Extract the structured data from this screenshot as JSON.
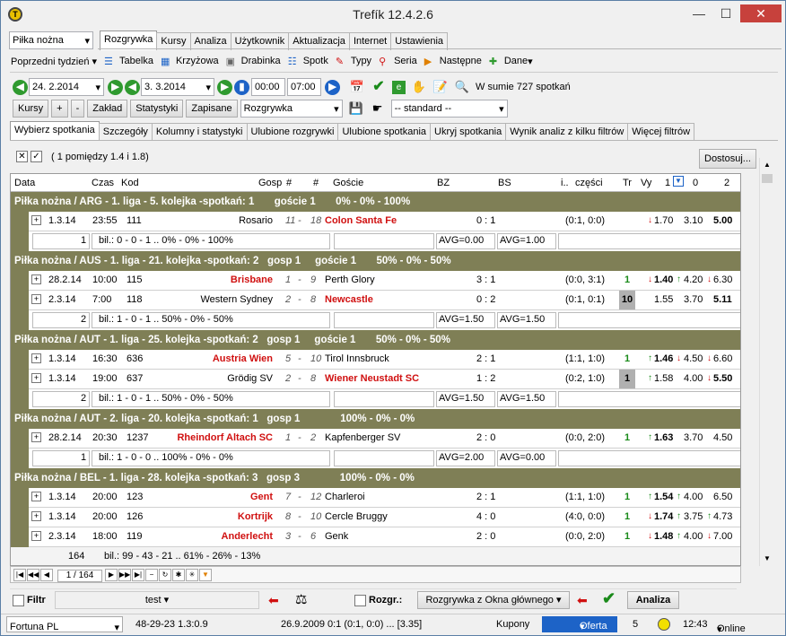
{
  "app": {
    "title": "Trefík 12.4.2.6"
  },
  "toolbar1": {
    "sport": "Piłka nożna",
    "period": "Poprzedni tydzień"
  },
  "main_tabs": [
    "Rozgrywka",
    "Kursy",
    "Analiza",
    "Użytkownik",
    "Aktualizacja",
    "Internet",
    "Ustawienia"
  ],
  "toolbar2": [
    "Tabelka",
    "Krzyżowa",
    "Drabinka",
    "Spotk",
    "Typy",
    "Seria",
    "Następne",
    "Dane"
  ],
  "toolbar3": {
    "date_from": "24. 2.2014",
    "date_to": "3. 3.2014",
    "time_from": "00:00",
    "time_to": "07:00",
    "total": "W sumie 727 spotkań"
  },
  "toolbar4": {
    "kursy": "Kursy",
    "plus": "+",
    "minus": "-",
    "zaklad": "Zakład",
    "statystyki": "Statystyki",
    "zapisane": "Zapisane",
    "rozgrywka": "Rozgrywka",
    "standard": "-- standard --"
  },
  "sub_tabs": [
    "Wybierz spotkania",
    "Szczegóły",
    "Kolumny i statystyki",
    "Ulubione rozgrywki",
    "Ulubione spotkania",
    "Ukryj spotkania",
    "Wynik analiz z kilku filtrów",
    "Więcej filtrów"
  ],
  "filter": {
    "text": "( 1 pomiędzy 1.4 i 1.8)",
    "dostosuj": "Dostosuj..."
  },
  "columns": {
    "data": "Data",
    "czas": "Czas",
    "kod": "Kod",
    "gosp": "Gosp",
    "h1": "#",
    "h2": "#",
    "goscie": "Goście",
    "bz": "BZ",
    "bs": "BS",
    "i": "i..",
    "czesci": "części",
    "tr": "Tr",
    "vy": "Vy",
    "c1": "1",
    "c0": "0",
    "c2": "2"
  },
  "groups": [
    {
      "title": "Piłka nożna / ARG - 1. liga - 5. kolejka -spotkań: 1       goście 1       0% - 0% - 100%",
      "matches": [
        {
          "date": "1.3.14",
          "time": "23:55",
          "code": "111",
          "home": "Rosario",
          "home_red": false,
          "h_rank": "11",
          "a_rank": "18",
          "away": "Colon Santa Fe",
          "away_red": true,
          "bz": "0 : 1",
          "ht": "(0:1, 0:0)",
          "tr": "",
          "vy": "",
          "o1": "1.70",
          "o0": "3.10",
          "o2": "5.00",
          "o1_arrow": "down",
          "o0_arrow": "",
          "o2_arrow": "",
          "bold": "o2",
          "gray": false
        }
      ],
      "summary": {
        "count": "1",
        "bil": "bil.: 0 - 0 - 1 .. 0% - 0% - 100%",
        "avg1": "AVG=0.00",
        "avg2": "AVG=1.00"
      }
    },
    {
      "title": "Piłka nożna / AUS - 1. liga - 21. kolejka -spotkań: 2   gosp 1     goście 1       50% - 0% - 50%",
      "matches": [
        {
          "date": "28.2.14",
          "time": "10:00",
          "code": "115",
          "home": "Brisbane",
          "home_red": true,
          "h_rank": "1",
          "a_rank": "9",
          "away": "Perth Glory",
          "away_red": false,
          "bz": "3 : 1",
          "ht": "(0:0, 3:1)",
          "tr": "1",
          "vy": "",
          "o1": "1.40",
          "o0": "4.20",
          "o2": "6.30",
          "o1_arrow": "down",
          "o0_arrow": "up",
          "o2_arrow": "down",
          "bold": "o1",
          "gray": false
        },
        {
          "date": "2.3.14",
          "time": "7:00",
          "code": "118",
          "home": "Western Sydney",
          "home_red": false,
          "h_rank": "2",
          "a_rank": "8",
          "away": "Newcastle",
          "away_red": true,
          "bz": "0 : 2",
          "ht": "(0:1, 0:1)",
          "tr": "10",
          "vy": "",
          "o1": "1.55",
          "o0": "3.70",
          "o2": "5.11",
          "o1_arrow": "",
          "o0_arrow": "",
          "o2_arrow": "",
          "bold": "o2",
          "gray": true
        }
      ],
      "summary": {
        "count": "2",
        "bil": "bil.: 1 - 0 - 1 .. 50% - 0% - 50%",
        "avg1": "AVG=1.50",
        "avg2": "AVG=1.50"
      }
    },
    {
      "title": "Piłka nożna / AUT - 1. liga - 25. kolejka -spotkań: 2   gosp 1     goście 1       50% - 0% - 50%",
      "matches": [
        {
          "date": "1.3.14",
          "time": "16:30",
          "code": "636",
          "home": "Austria Wien",
          "home_red": true,
          "h_rank": "5",
          "a_rank": "10",
          "away": "Tirol Innsbruck",
          "away_red": false,
          "bz": "2 : 1",
          "ht": "(1:1, 1:0)",
          "tr": "1",
          "vy": "",
          "o1": "1.46",
          "o0": "4.50",
          "o2": "6.60",
          "o1_arrow": "up",
          "o0_arrow": "down",
          "o2_arrow": "down",
          "bold": "o1",
          "gray": false
        },
        {
          "date": "1.3.14",
          "time": "19:00",
          "code": "637",
          "home": "Grödig SV",
          "home_red": false,
          "h_rank": "2",
          "a_rank": "8",
          "away": "Wiener Neustadt SC",
          "away_red": true,
          "bz": "1 : 2",
          "ht": "(0:2, 1:0)",
          "tr": "1",
          "vy": "",
          "o1": "1.58",
          "o0": "4.00",
          "o2": "5.50",
          "o1_arrow": "up",
          "o0_arrow": "",
          "o2_arrow": "down",
          "bold": "o2",
          "gray": true
        }
      ],
      "summary": {
        "count": "2",
        "bil": "bil.: 1 - 0 - 1 .. 50% - 0% - 50%",
        "avg1": "AVG=1.50",
        "avg2": "AVG=1.50"
      }
    },
    {
      "title": "Piłka nożna / AUT - 2. liga - 20. kolejka -spotkań: 1   gosp 1              100% - 0% - 0%",
      "matches": [
        {
          "date": "28.2.14",
          "time": "20:30",
          "code": "1237",
          "home": "Rheindorf Altach SC",
          "home_red": true,
          "h_rank": "1",
          "a_rank": "2",
          "away": "Kapfenberger SV",
          "away_red": false,
          "bz": "2 : 0",
          "ht": "(0:0, 2:0)",
          "tr": "1",
          "vy": "",
          "o1": "1.63",
          "o0": "3.70",
          "o2": "4.50",
          "o1_arrow": "up",
          "o0_arrow": "",
          "o2_arrow": "",
          "bold": "o1",
          "gray": false
        }
      ],
      "summary": {
        "count": "1",
        "bil": "bil.: 1 - 0 - 0 .. 100% - 0% - 0%",
        "avg1": "AVG=2.00",
        "avg2": "AVG=0.00"
      }
    },
    {
      "title": "Piłka nożna / BEL - 1. liga - 28. kolejka -spotkań: 3   gosp 3              100% - 0% - 0%",
      "matches": [
        {
          "date": "1.3.14",
          "time": "20:00",
          "code": "123",
          "home": "Gent",
          "home_red": true,
          "h_rank": "7",
          "a_rank": "12",
          "away": "Charleroi",
          "away_red": false,
          "bz": "2 : 1",
          "ht": "(1:1, 1:0)",
          "tr": "1",
          "vy": "",
          "o1": "1.54",
          "o0": "4.00",
          "o2": "6.50",
          "o1_arrow": "up",
          "o0_arrow": "up",
          "o2_arrow": "",
          "bold": "o1",
          "gray": false
        },
        {
          "date": "1.3.14",
          "time": "20:00",
          "code": "126",
          "home": "Kortrijk",
          "home_red": true,
          "h_rank": "8",
          "a_rank": "10",
          "away": "Cercle Bruggy",
          "away_red": false,
          "bz": "4 : 0",
          "ht": "(4:0, 0:0)",
          "tr": "1",
          "vy": "",
          "o1": "1.74",
          "o0": "3.75",
          "o2": "4.73",
          "o1_arrow": "down",
          "o0_arrow": "up",
          "o2_arrow": "up",
          "bold": "o1",
          "gray": false
        },
        {
          "date": "2.3.14",
          "time": "18:00",
          "code": "119",
          "home": "Anderlecht",
          "home_red": true,
          "h_rank": "3",
          "a_rank": "6",
          "away": "Genk",
          "away_red": false,
          "bz": "2 : 0",
          "ht": "(0:0, 2:0)",
          "tr": "1",
          "vy": "",
          "o1": "1.48",
          "o0": "4.00",
          "o2": "7.00",
          "o1_arrow": "down",
          "o0_arrow": "up",
          "o2_arrow": "down",
          "bold": "o1",
          "gray": false
        }
      ],
      "summary": null
    }
  ],
  "grand_total": {
    "count": "164",
    "bil": "bil.: 99 - 43 - 21 .. 61% - 26% - 13%"
  },
  "pager": {
    "page": "1 / 164"
  },
  "bottom": {
    "filtr": "Filtr",
    "test": "test",
    "rozgr": "Rozgr.:",
    "rozgr_dd": "Rozgrywka z Okna głównego",
    "analiza": "Analiza"
  },
  "statusbar": {
    "bookmaker": "Fortuna PL",
    "stat": "48-29-23  1.3:0.9",
    "last": "26.9.2009 0:1 (0:1, 0:0) ... [3.35]",
    "kupony": "Kupony",
    "oferta": "Oferta",
    "num": "5",
    "time": "12:43",
    "online": "Online"
  },
  "colors": {
    "group_bg": "#7f7f56",
    "red_team": "#d01010",
    "accent": "#1d63c7",
    "close": "#c7413c"
  }
}
